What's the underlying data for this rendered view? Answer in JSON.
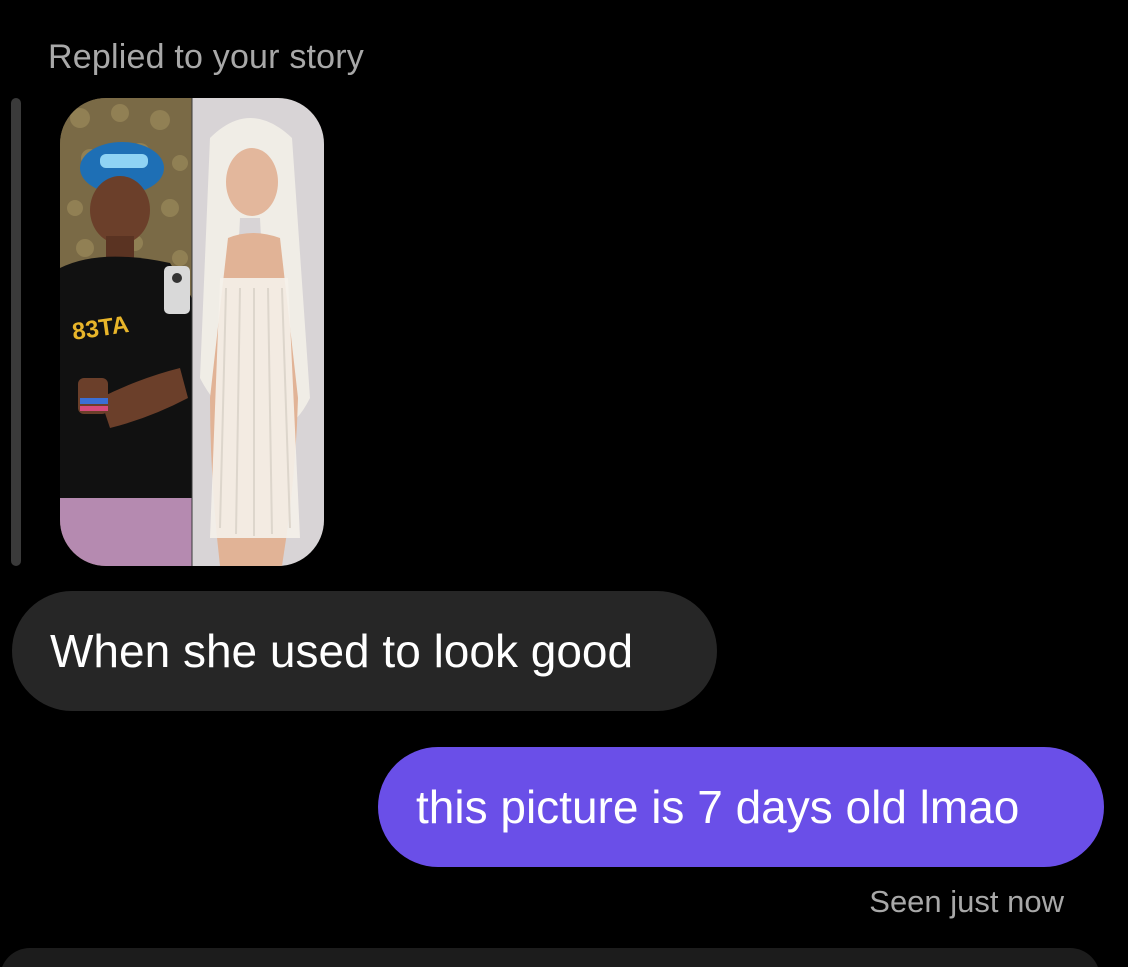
{
  "thread": {
    "reply_label": "Replied to your story",
    "story_image": "story-photo",
    "messages": [
      {
        "direction": "incoming",
        "text": "When she used to look good"
      },
      {
        "direction": "outgoing",
        "text": "this picture is 7 days old lmao"
      }
    ],
    "seen_status": "Seen just now"
  },
  "colors": {
    "background": "#000000",
    "incoming_bubble": "#262626",
    "outgoing_bubble": "#6a4fe8",
    "secondary_text": "#a8a8a8",
    "primary_text": "#ffffff"
  }
}
